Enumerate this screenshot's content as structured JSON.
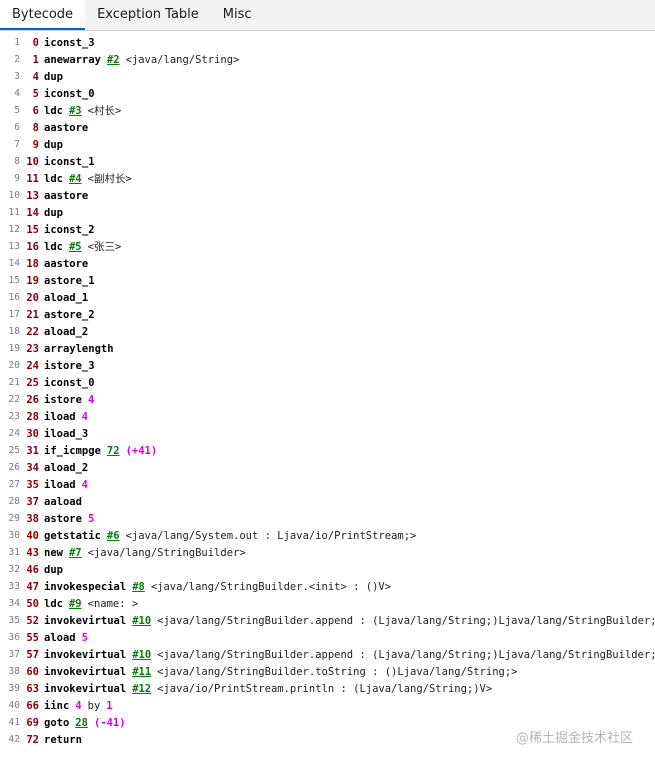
{
  "tabs": [
    {
      "label": "Bytecode",
      "active": true
    },
    {
      "label": "Exception Table",
      "active": false
    },
    {
      "label": "Misc",
      "active": false
    }
  ],
  "watermark": "@稀土掘金技术社区",
  "colors": {
    "offset": "#8b0000",
    "ref": "#0a7a0a",
    "arg": "#e000e0",
    "line_number": "#7b7b7b"
  },
  "lines": [
    {
      "ln": "1",
      "offset": "0",
      "op": "iconst_3"
    },
    {
      "ln": "2",
      "offset": "1",
      "op": "anewarray",
      "ref": "#2",
      "note": "<java/lang/String>"
    },
    {
      "ln": "3",
      "offset": "4",
      "op": "dup"
    },
    {
      "ln": "4",
      "offset": "5",
      "op": "iconst_0"
    },
    {
      "ln": "5",
      "offset": "6",
      "op": "ldc",
      "ref": "#3",
      "note": "<村长>"
    },
    {
      "ln": "6",
      "offset": "8",
      "op": "aastore"
    },
    {
      "ln": "7",
      "offset": "9",
      "op": "dup"
    },
    {
      "ln": "8",
      "offset": "10",
      "op": "iconst_1"
    },
    {
      "ln": "9",
      "offset": "11",
      "op": "ldc",
      "ref": "#4",
      "note": "<副村长>"
    },
    {
      "ln": "10",
      "offset": "13",
      "op": "aastore"
    },
    {
      "ln": "11",
      "offset": "14",
      "op": "dup"
    },
    {
      "ln": "12",
      "offset": "15",
      "op": "iconst_2"
    },
    {
      "ln": "13",
      "offset": "16",
      "op": "ldc",
      "ref": "#5",
      "note": "<张三>"
    },
    {
      "ln": "14",
      "offset": "18",
      "op": "aastore"
    },
    {
      "ln": "15",
      "offset": "19",
      "op": "astore_1"
    },
    {
      "ln": "16",
      "offset": "20",
      "op": "aload_1"
    },
    {
      "ln": "17",
      "offset": "21",
      "op": "astore_2"
    },
    {
      "ln": "18",
      "offset": "22",
      "op": "aload_2"
    },
    {
      "ln": "19",
      "offset": "23",
      "op": "arraylength"
    },
    {
      "ln": "20",
      "offset": "24",
      "op": "istore_3"
    },
    {
      "ln": "21",
      "offset": "25",
      "op": "iconst_0"
    },
    {
      "ln": "22",
      "offset": "26",
      "op": "istore",
      "arg": "4"
    },
    {
      "ln": "23",
      "offset": "28",
      "op": "iload",
      "arg": "4"
    },
    {
      "ln": "24",
      "offset": "30",
      "op": "iload_3"
    },
    {
      "ln": "25",
      "offset": "31",
      "op": "if_icmpge",
      "ref": "72",
      "arg": "(+41)"
    },
    {
      "ln": "26",
      "offset": "34",
      "op": "aload_2"
    },
    {
      "ln": "27",
      "offset": "35",
      "op": "iload",
      "arg": "4"
    },
    {
      "ln": "28",
      "offset": "37",
      "op": "aaload"
    },
    {
      "ln": "29",
      "offset": "38",
      "op": "astore",
      "arg": "5"
    },
    {
      "ln": "30",
      "offset": "40",
      "op": "getstatic",
      "ref": "#6",
      "note": "<java/lang/System.out : Ljava/io/PrintStream;>"
    },
    {
      "ln": "31",
      "offset": "43",
      "op": "new",
      "ref": "#7",
      "note": "<java/lang/StringBuilder>"
    },
    {
      "ln": "32",
      "offset": "46",
      "op": "dup"
    },
    {
      "ln": "33",
      "offset": "47",
      "op": "invokespecial",
      "ref": "#8",
      "note": "<java/lang/StringBuilder.<init> : ()V>"
    },
    {
      "ln": "34",
      "offset": "50",
      "op": "ldc",
      "ref": "#9",
      "note": "<name: >"
    },
    {
      "ln": "35",
      "offset": "52",
      "op": "invokevirtual",
      "ref": "#10",
      "note": "<java/lang/StringBuilder.append : (Ljava/lang/String;)Ljava/lang/StringBuilder;>"
    },
    {
      "ln": "36",
      "offset": "55",
      "op": "aload",
      "arg": "5"
    },
    {
      "ln": "37",
      "offset": "57",
      "op": "invokevirtual",
      "ref": "#10",
      "note": "<java/lang/StringBuilder.append : (Ljava/lang/String;)Ljava/lang/StringBuilder;>"
    },
    {
      "ln": "38",
      "offset": "60",
      "op": "invokevirtual",
      "ref": "#11",
      "note": "<java/lang/StringBuilder.toString : ()Ljava/lang/String;>"
    },
    {
      "ln": "39",
      "offset": "63",
      "op": "invokevirtual",
      "ref": "#12",
      "note": "<java/io/PrintStream.println : (Ljava/lang/String;)V>"
    },
    {
      "ln": "40",
      "offset": "66",
      "op": "iinc",
      "arg": "4",
      "note": "by",
      "arg2": "1"
    },
    {
      "ln": "41",
      "offset": "69",
      "op": "goto",
      "ref": "28",
      "arg": "(-41)"
    },
    {
      "ln": "42",
      "offset": "72",
      "op": "return"
    }
  ]
}
